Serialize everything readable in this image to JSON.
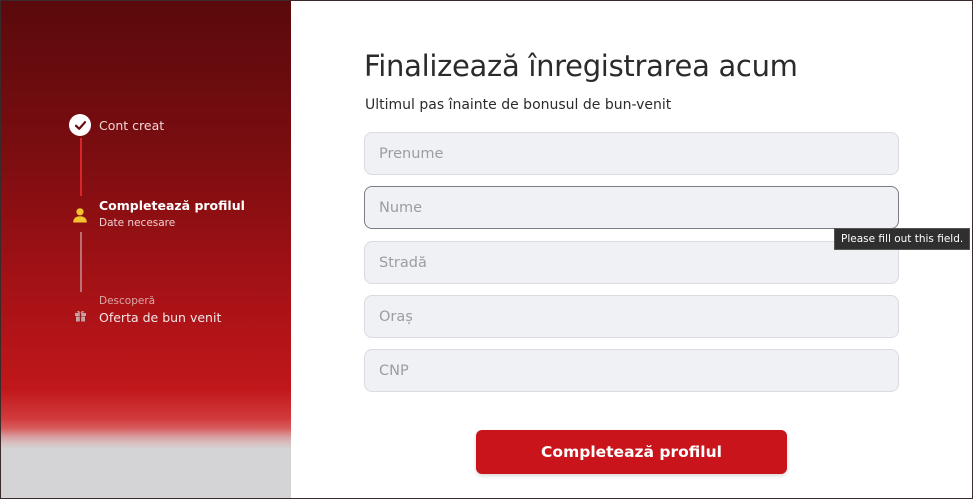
{
  "steps": [
    {
      "title": "Cont creat",
      "subtitle": "",
      "state": "done",
      "icon": "check-icon"
    },
    {
      "title": "Completează profilul",
      "subtitle": "Date necesare",
      "state": "active",
      "icon": "user-icon"
    },
    {
      "title": "Oferta de bun venit",
      "subtitle": "Descoperă",
      "state": "pending",
      "icon": "gift-icon"
    }
  ],
  "form": {
    "heading": "Finalizează înregistrarea acum",
    "subheading": "Ultimul pas înainte de bonusul de bun-venit",
    "fields": [
      {
        "placeholder": "Prenume",
        "value": ""
      },
      {
        "placeholder": "Nume",
        "value": ""
      },
      {
        "placeholder": "Stradă",
        "value": ""
      },
      {
        "placeholder": "Oraș",
        "value": ""
      },
      {
        "placeholder": "CNP",
        "value": ""
      }
    ],
    "validation_tooltip": "Please fill out this field.",
    "submit_label": "Completează profilul"
  },
  "colors": {
    "accent": "#c8141a",
    "sidebar_dark": "#5a0a0c",
    "active_icon": "#f2c230"
  }
}
